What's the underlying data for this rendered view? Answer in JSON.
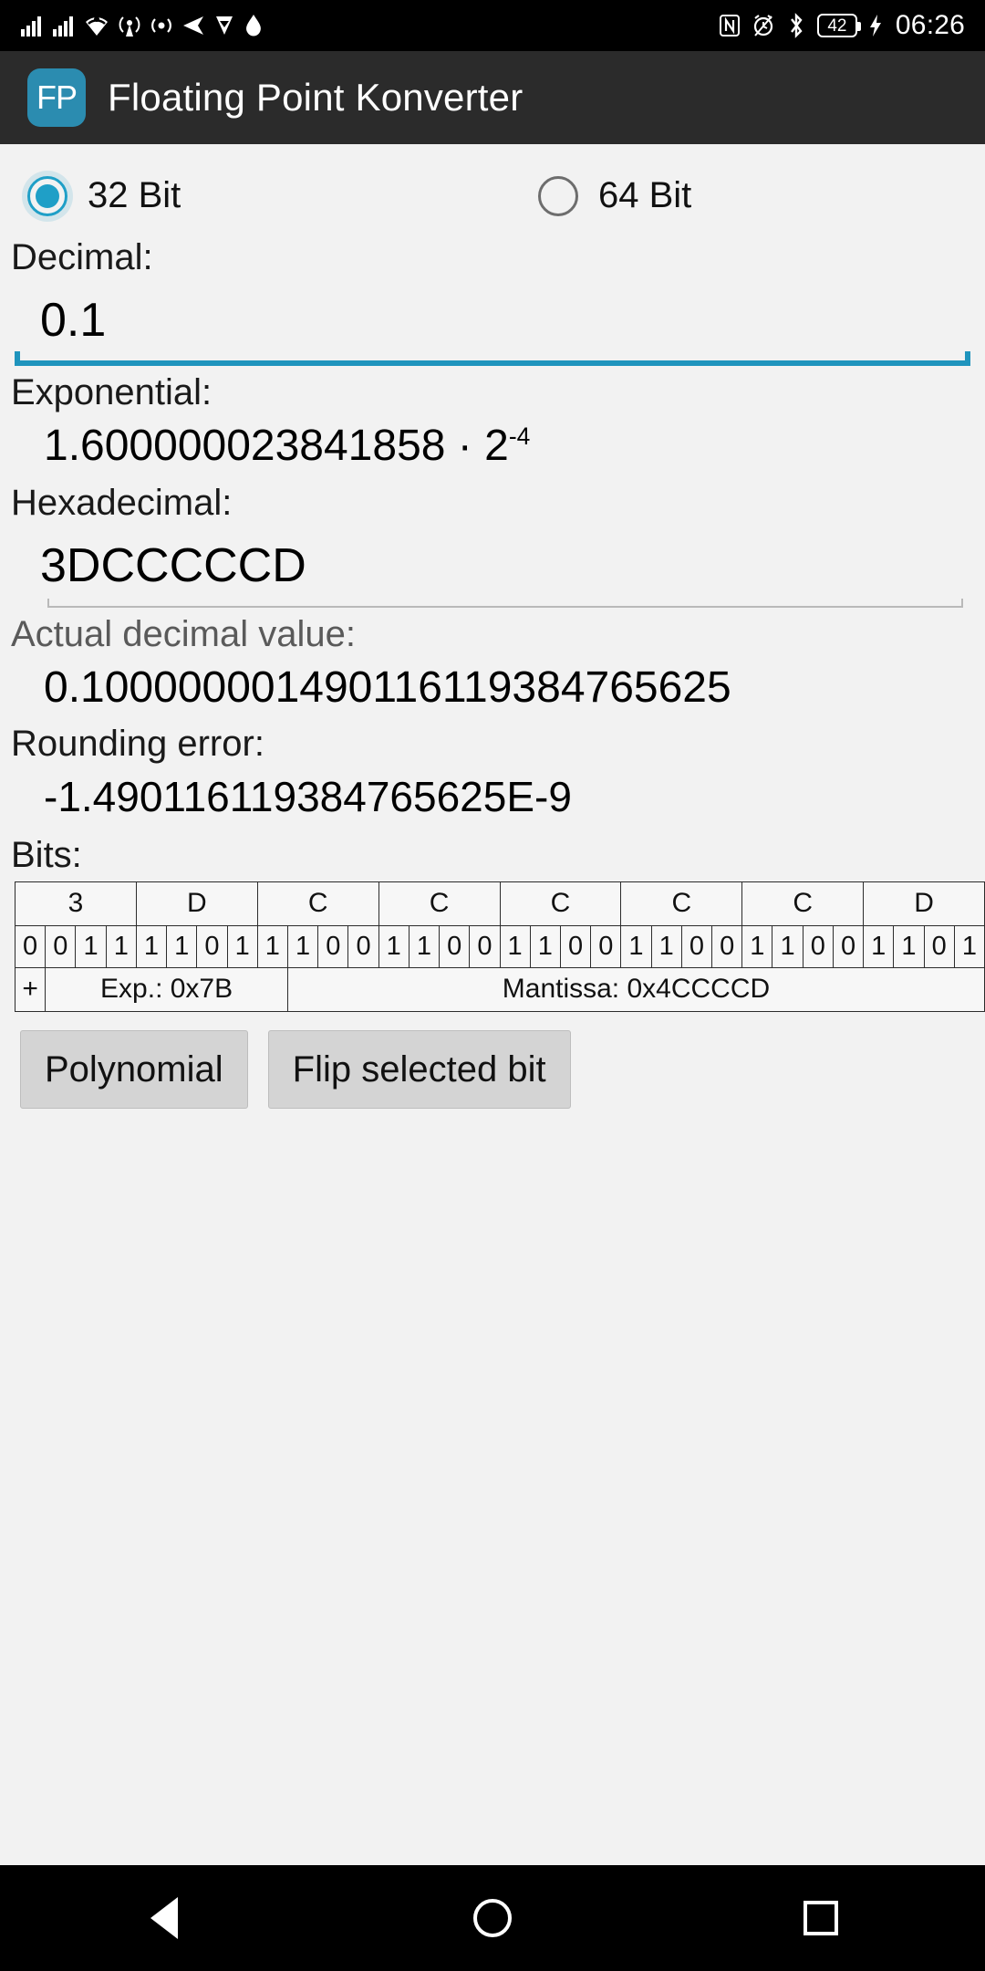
{
  "statusbar": {
    "icons_left": [
      "signal-bars-icon",
      "signal-bars-icon",
      "wifi-icon",
      "cell-tower-icon",
      "broadcast-icon",
      "send-arrow-icon",
      "check-badge-icon",
      "diamond-icon"
    ],
    "icons_right": [
      "nfc-icon",
      "alarm-icon",
      "bluetooth-icon"
    ],
    "battery_level": "42",
    "charging_icon": "charging-bolt-icon",
    "time": "06:26"
  },
  "appbar": {
    "logo_text": "FP",
    "logo_color": "#2b8cb0",
    "title": "Floating Point Konverter"
  },
  "precision": {
    "options": [
      {
        "label": "32 Bit",
        "selected": true
      },
      {
        "label": "64 Bit",
        "selected": false
      }
    ],
    "accent_color": "#1f9fc7"
  },
  "decimal": {
    "label": "Decimal:",
    "value": "0.1",
    "placeholder": "Decimal"
  },
  "exponential": {
    "label": "Exponential:",
    "mantissa": "1.600000023841858 · 2",
    "exponent": "-4"
  },
  "hexadecimal": {
    "label": "Hexadecimal:",
    "value": "3DCCCCCD",
    "placeholder": "Hexadecimal"
  },
  "actual_decimal": {
    "label": "Actual decimal value:",
    "value": "0.100000001490116119384765625"
  },
  "rounding_error": {
    "label": "Rounding error:",
    "value": "-1.490116119384765625E-9"
  },
  "bits": {
    "label": "Bits:",
    "hex_nibbles": [
      "3",
      "D",
      "C",
      "C",
      "C",
      "C",
      "C",
      "D"
    ],
    "bit_values": [
      "0",
      "0",
      "1",
      "1",
      "1",
      "1",
      "0",
      "1",
      "1",
      "1",
      "0",
      "0",
      "1",
      "1",
      "0",
      "0",
      "1",
      "1",
      "0",
      "0",
      "1",
      "1",
      "0",
      "0",
      "1",
      "1",
      "0",
      "0",
      "1",
      "1",
      "0",
      "1"
    ],
    "sign_label": "+",
    "exponent_label": "Exp.: 0x7B",
    "mantissa_label": "Mantissa: 0x4CCCCD"
  },
  "buttons": {
    "polynomial": "Polynomial",
    "flip_selected_bit": "Flip selected bit"
  },
  "navbar": {
    "back": "back-triangle-icon",
    "home": "home-circle-icon",
    "recent": "recent-square-icon"
  }
}
